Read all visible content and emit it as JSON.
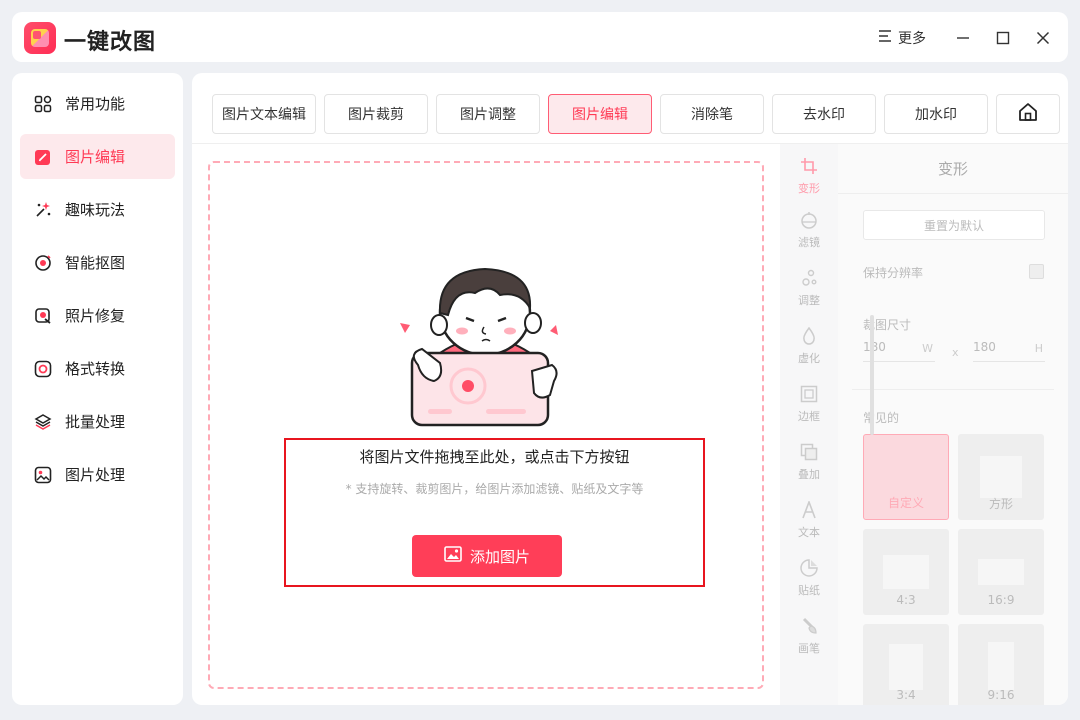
{
  "app": {
    "title": "一键改图"
  },
  "titlebar": {
    "more_label": "更多"
  },
  "sidebar": {
    "items": [
      {
        "label": "常用功能",
        "icon": "grid-icon"
      },
      {
        "label": "图片编辑",
        "icon": "edit-icon",
        "active": true
      },
      {
        "label": "趣味玩法",
        "icon": "sparkle-icon"
      },
      {
        "label": "智能抠图",
        "icon": "target-icon"
      },
      {
        "label": "照片修复",
        "icon": "repair-icon"
      },
      {
        "label": "格式转换",
        "icon": "convert-icon"
      },
      {
        "label": "批量处理",
        "icon": "layers-icon"
      },
      {
        "label": "图片处理",
        "icon": "image-icon"
      }
    ]
  },
  "tabs": [
    {
      "label": "图片文本编辑"
    },
    {
      "label": "图片裁剪"
    },
    {
      "label": "图片调整"
    },
    {
      "label": "图片编辑",
      "active": true
    },
    {
      "label": "消除笔"
    },
    {
      "label": "去水印"
    },
    {
      "label": "加水印"
    }
  ],
  "dropzone": {
    "title": "将图片文件拖拽至此处，或点击下方按钮",
    "subtitle": "* 支持旋转、裁剪图片，给图片添加滤镜、贴纸及文字等",
    "add_button": "添加图片"
  },
  "tools": [
    {
      "label": "变形",
      "icon": "crop-icon",
      "active": true
    },
    {
      "label": "滤镜",
      "icon": "filter-icon"
    },
    {
      "label": "调整",
      "icon": "adjust-icon"
    },
    {
      "label": "虚化",
      "icon": "blur-icon"
    },
    {
      "label": "边框",
      "icon": "frame-icon"
    },
    {
      "label": "叠加",
      "icon": "overlay-icon"
    },
    {
      "label": "文本",
      "icon": "text-icon"
    },
    {
      "label": "贴纸",
      "icon": "sticker-icon"
    },
    {
      "label": "画笔",
      "icon": "brush-icon"
    }
  ],
  "panel": {
    "title": "变形",
    "reset_label": "重置为默认",
    "keep_resolution_label": "保持分辨率",
    "crop_size_label": "裁图尺寸",
    "width_value": "180",
    "width_unit": "W",
    "times": "x",
    "height_value": "180",
    "height_unit": "H",
    "common_label": "常见的",
    "presets": [
      {
        "label": "自定义",
        "active": true
      },
      {
        "label": "方形"
      },
      {
        "label": "4:3"
      },
      {
        "label": "16:9"
      },
      {
        "label": "3:4"
      },
      {
        "label": "9:16"
      }
    ]
  },
  "colors": {
    "accent": "#ff3e58",
    "accent_light": "#fde9ec",
    "highlight_box": "#e8151f"
  }
}
